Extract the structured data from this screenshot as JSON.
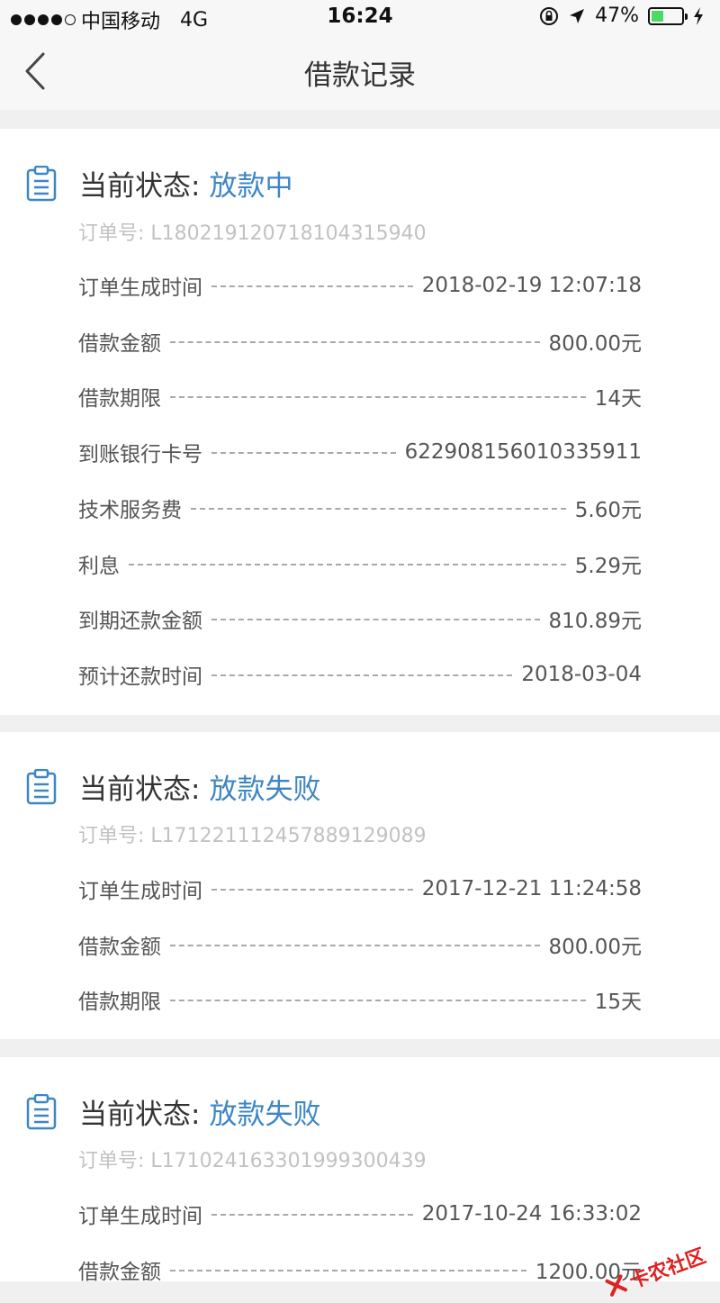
{
  "status_bar": {
    "carrier": "中国移动",
    "network": "4G",
    "time": "16:24",
    "battery_percent": "47%",
    "battery_level": 0.47
  },
  "nav": {
    "title": "借款记录"
  },
  "cards": [
    {
      "status_label": "当前状态:",
      "status_value": "放款中",
      "order_no": "订单号: L18021912071810431594​0",
      "rows": [
        {
          "label": "订单生成时间",
          "value": "2018-02-19 12:07:18"
        },
        {
          "label": "借款金额",
          "value": "800.00元"
        },
        {
          "label": "借款期限",
          "value": "14天"
        },
        {
          "label": "到账银行卡号",
          "value": "6229081560103359​11"
        },
        {
          "label": "技术服务费",
          "value": "5.60元"
        },
        {
          "label": "利息",
          "value": "5.29元"
        },
        {
          "label": "到期还款金额",
          "value": "810.89元"
        },
        {
          "label": "预计还款时间",
          "value": "2018-03-04"
        }
      ]
    },
    {
      "status_label": "当前状态:",
      "status_value": "放款失败",
      "order_no": "订单号: L17122111245788912908​9",
      "rows": [
        {
          "label": "订单生成时间",
          "value": "2017-12-21 11:24:58"
        },
        {
          "label": "借款金额",
          "value": "800.00元"
        },
        {
          "label": "借款期限",
          "value": "15天"
        }
      ]
    },
    {
      "status_label": "当前状态:",
      "status_value": "放款失败",
      "order_no": "订单号: L17102416330199930043​9",
      "rows": [
        {
          "label": "订单生成时间",
          "value": "2017-10-24 16:33:02"
        },
        {
          "label": "借款金额",
          "value": "1200.00元"
        }
      ]
    }
  ],
  "watermark": {
    "text": "卡农社区"
  },
  "colors": {
    "accent": "#3d86c6",
    "background": "#f0f0f0",
    "card": "#ffffff",
    "muted_text": "#c2c2c2"
  }
}
